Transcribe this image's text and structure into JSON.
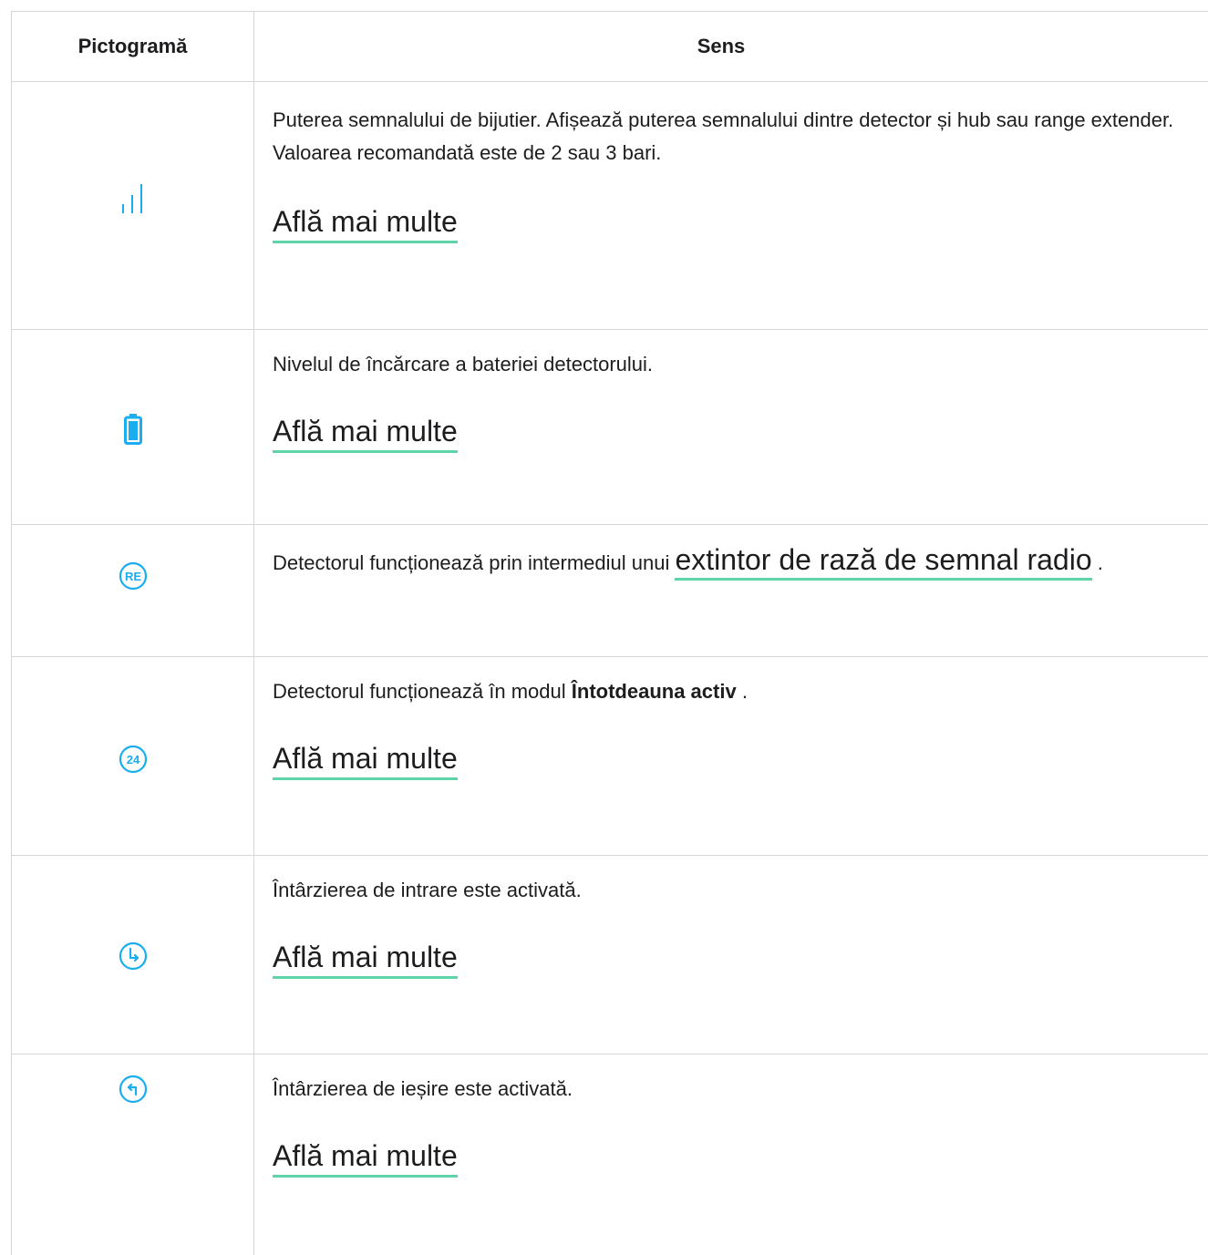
{
  "header": {
    "icon_col": "Pictogramă",
    "meaning_col": "Sens"
  },
  "accent_color": "#1aaef0",
  "link_underline_color": "#5fd4a8",
  "rows": [
    {
      "icon": "signal-strength-icon",
      "description": "Puterea semnalului de bijutier. Afișează puterea semnalului dintre detector și hub sau range extender. Valoarea recomandată este de 2 sau 3 bari.",
      "link": "Află mai multe"
    },
    {
      "icon": "battery-icon",
      "description": "Nivelul de încărcare a bateriei detectorului.",
      "link": "Află mai multe"
    },
    {
      "icon": "range-extender-icon",
      "icon_text": "RE",
      "description_before": "Detectorul funcționează prin intermediul unui",
      "inline_link": "extintor de rază de semnal radio",
      "description_after": "."
    },
    {
      "icon": "always-active-icon",
      "icon_text": "24",
      "description_before": "Detectorul funcționează în modul",
      "description_bold": "Întotdeauna activ",
      "description_after": ".",
      "link": "Află mai multe"
    },
    {
      "icon": "entry-delay-icon",
      "description": "Întârzierea de intrare este activată.",
      "link": "Află mai multe"
    },
    {
      "icon": "exit-delay-icon",
      "description": "Întârzierea de ieșire este activată.",
      "link": "Află mai multe"
    }
  ]
}
